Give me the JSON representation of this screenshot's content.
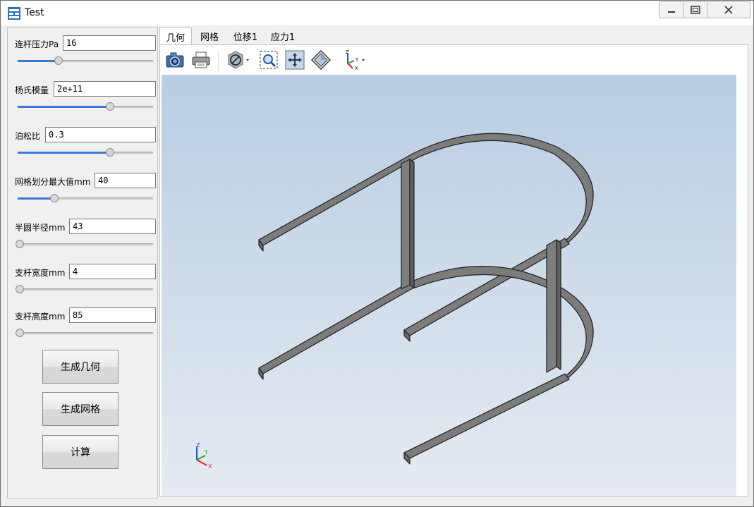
{
  "window": {
    "title": "Test"
  },
  "params": [
    {
      "label": "连杆压力Pa",
      "value": "16",
      "slider_fraction": 0.3
    },
    {
      "label": "杨氏模量",
      "value": "2e+11",
      "slider_fraction": 0.68
    },
    {
      "label": "泊松比",
      "value": "0.3",
      "slider_fraction": 0.68
    },
    {
      "label": "网格划分最大值mm",
      "value": "40",
      "slider_fraction": 0.27
    },
    {
      "label": "半圆半径mm",
      "value": "43",
      "slider_fraction": 0.0
    },
    {
      "label": "支杆宽度mm",
      "value": "4",
      "slider_fraction": 0.0
    },
    {
      "label": "支杆高度mm",
      "value": "85",
      "slider_fraction": 0.0
    }
  ],
  "buttons": {
    "generate_geometry": "生成几何",
    "generate_mesh": "生成网格",
    "compute": "计算"
  },
  "tabs": [
    {
      "label": "几何",
      "active": true
    },
    {
      "label": "网格",
      "active": false
    },
    {
      "label": "位移1",
      "active": false
    },
    {
      "label": "应力1",
      "active": false
    }
  ],
  "toolbar_icons": [
    "camera-icon",
    "printer-icon",
    "hide-icon",
    "zoom-box-icon",
    "zoom-extents-icon",
    "view-select-icon",
    "axis-orientation-icon"
  ],
  "axis_labels": {
    "x": "X",
    "y": "Y",
    "z": "Z"
  },
  "colors": {
    "accent": "#3a78d4",
    "viewport_top": "#b9cde3",
    "viewport_bottom": "#e6ebf1",
    "model": "#8a8a8a"
  }
}
